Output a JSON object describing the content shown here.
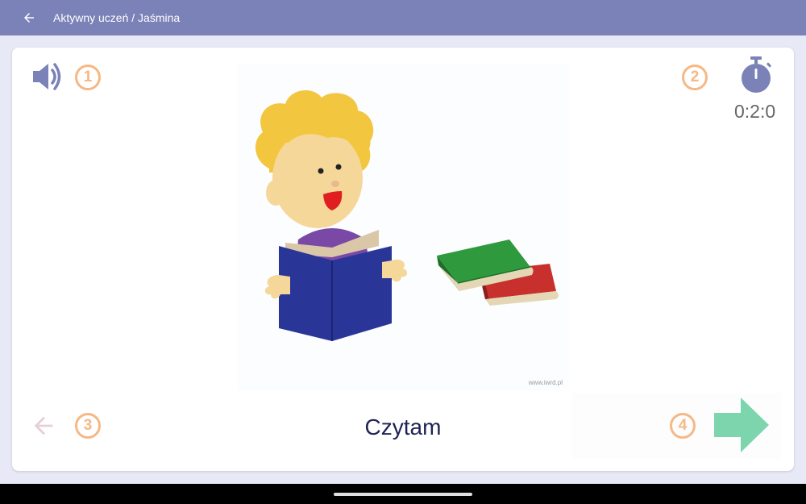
{
  "appbar": {
    "title": "Aktywny uczeń / Jaśmina",
    "back_icon": "arrow-left-icon",
    "background_color": "#7a82b7"
  },
  "card": {
    "sound": {
      "icon": "speaker-icon",
      "badge": "1"
    },
    "timer": {
      "icon": "stopwatch-icon",
      "badge": "2",
      "value": "0:2:0"
    },
    "picture": {
      "subject": "child-reading-book-with-stack-of-books",
      "watermark": "www.iwrd.pl"
    },
    "previous": {
      "icon": "arrow-left-icon",
      "badge": "3",
      "enabled": false
    },
    "next": {
      "icon": "arrow-right-icon",
      "badge": "4",
      "color": "#7dd5ae"
    },
    "caption": "Czytam"
  },
  "colors": {
    "accent": "#7a82b7",
    "badge": "#f6b884",
    "caption_text": "#1e2356",
    "next_arrow": "#7dd5ae",
    "disabled_arrow": "#e8cfd6"
  }
}
